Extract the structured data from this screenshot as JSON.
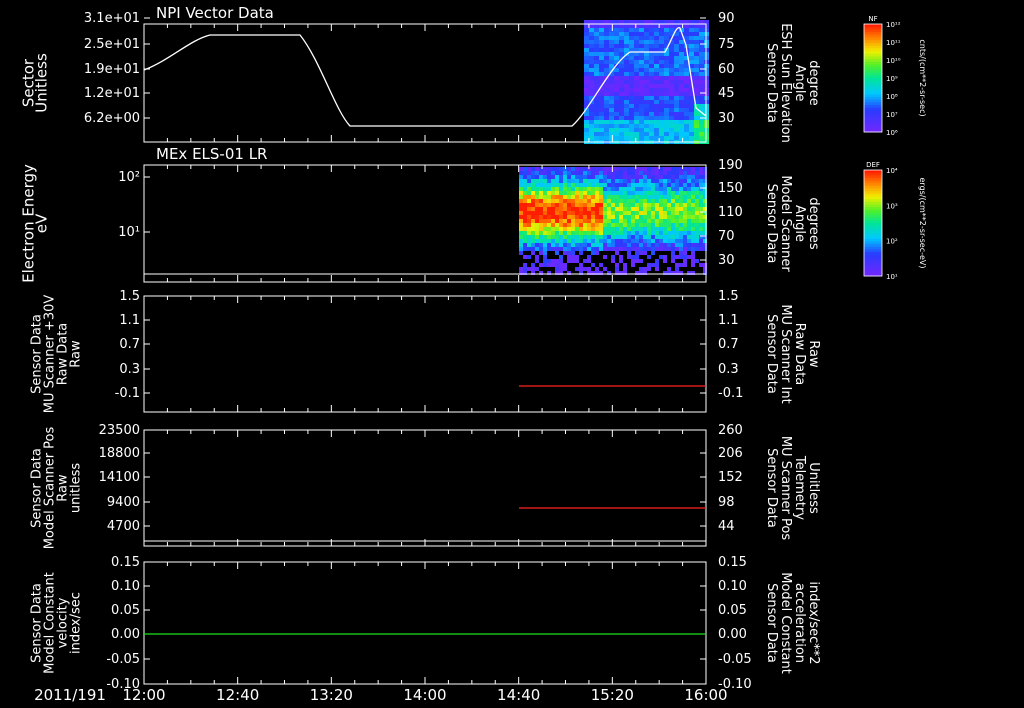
{
  "date_label": "2011/191",
  "time_ticks": [
    "12:00",
    "12:40",
    "13:20",
    "14:00",
    "14:40",
    "15:20",
    "16:00"
  ],
  "colors": {
    "trace_white": "#ffffff",
    "trace_red": "#ff2020",
    "trace_green": "#20e020",
    "axis": "#ffffff"
  },
  "panels": [
    {
      "title": "NPI Vector Data",
      "left_label": [
        "Sector",
        "Unitless"
      ],
      "left_ticks": [
        "3.1e+01",
        "2.5e+01",
        "1.9e+01",
        "1.2e+01",
        "6.2e+00"
      ],
      "right_label": [
        "Sensor Data",
        "ESH Sun Elevation",
        "Angle",
        "degree"
      ],
      "right_ticks": [
        "90",
        "75",
        "60",
        "45",
        "30"
      ]
    },
    {
      "title": "MEx ELS-01 LR",
      "left_label": [
        "Electron Energy",
        "eV"
      ],
      "left_ticks": [
        "10²",
        "10¹"
      ],
      "right_label": [
        "Sensor Data",
        "Model Scanner",
        "Angle",
        "degrees"
      ],
      "right_ticks": [
        "190",
        "150",
        "110",
        "70",
        "30"
      ]
    },
    {
      "title": "",
      "left_label": [
        "Sensor Data",
        "MU Scanner +30V",
        "Raw Data",
        "Raw"
      ],
      "left_ticks": [
        "1.5",
        "1.1",
        "0.7",
        "0.3",
        "-0.1"
      ],
      "right_label": [
        "Sensor Data",
        "MU Scanner Int",
        "Raw Data",
        "Raw"
      ],
      "right_ticks": [
        "1.5",
        "1.1",
        "0.7",
        "0.3",
        "-0.1"
      ]
    },
    {
      "title": "",
      "left_label": [
        "Sensor Data",
        "Model Scanner Pos",
        "Raw",
        "unitless"
      ],
      "left_ticks": [
        "23500",
        "18800",
        "14100",
        "9400",
        "4700"
      ],
      "right_label": [
        "Sensor Data",
        "MU Scanner Pos",
        "Telemetry",
        "Unitless"
      ],
      "right_ticks": [
        "260",
        "206",
        "152",
        "98",
        "44"
      ]
    },
    {
      "title": "",
      "left_label": [
        "Sensor Data",
        "Model Constant",
        "velocity",
        "index/sec"
      ],
      "left_ticks": [
        "0.15",
        "0.10",
        "0.05",
        "0.00",
        "-0.05",
        "-0.10"
      ],
      "right_label": [
        "Sensor Data",
        "Model Constant",
        "acceleration",
        "index/sec**2"
      ],
      "right_ticks": [
        "0.15",
        "0.10",
        "0.05",
        "0.00",
        "-0.05",
        "-0.10"
      ]
    }
  ],
  "colorbars": [
    {
      "label": "NF",
      "unit": "cnts/(cm**2-sr-sec)",
      "ticks": [
        "10¹²",
        "10¹¹",
        "10¹⁰",
        "10⁹",
        "10⁸",
        "10⁷",
        "10⁶"
      ]
    },
    {
      "label": "DEF",
      "unit": "ergs/(cm**2-sr-sec-eV)",
      "ticks": [
        "10⁴",
        "10³",
        "10²",
        "10¹"
      ]
    }
  ],
  "chart_data": [
    {
      "type": "line",
      "title": "NPI Vector Data",
      "series": [
        {
          "values_x_min": [
            0,
            40,
            65,
            80,
            90,
            120,
            195,
            205,
            215,
            235,
            240
          ]
        }
      ],
      "xlabel": "",
      "ylabel": "Sector Unitless",
      "ylim": [
        0,
        31
      ]
    },
    {
      "type": "heatmap",
      "title": "MEx ELS-01 LR",
      "ylabel": "Electron Energy eV",
      "ylim": [
        1,
        200
      ]
    },
    {
      "type": "line",
      "ylabel": "Sensor Data MU Scanner +30V Raw Data Raw",
      "ylim": [
        -0.3,
        1.5
      ],
      "series_start": "14:40",
      "series_value": -0.1
    },
    {
      "type": "line",
      "ylabel": "Sensor Data Model Scanner Pos Raw unitless",
      "ylim": [
        0,
        23500
      ],
      "series_start": "14:40",
      "series_value": 98
    },
    {
      "type": "line",
      "ylabel": "Sensor Data Model Constant velocity index/sec",
      "ylim": [
        -0.1,
        0.15
      ],
      "series_start": "12:00",
      "series_value": 0.0
    }
  ]
}
